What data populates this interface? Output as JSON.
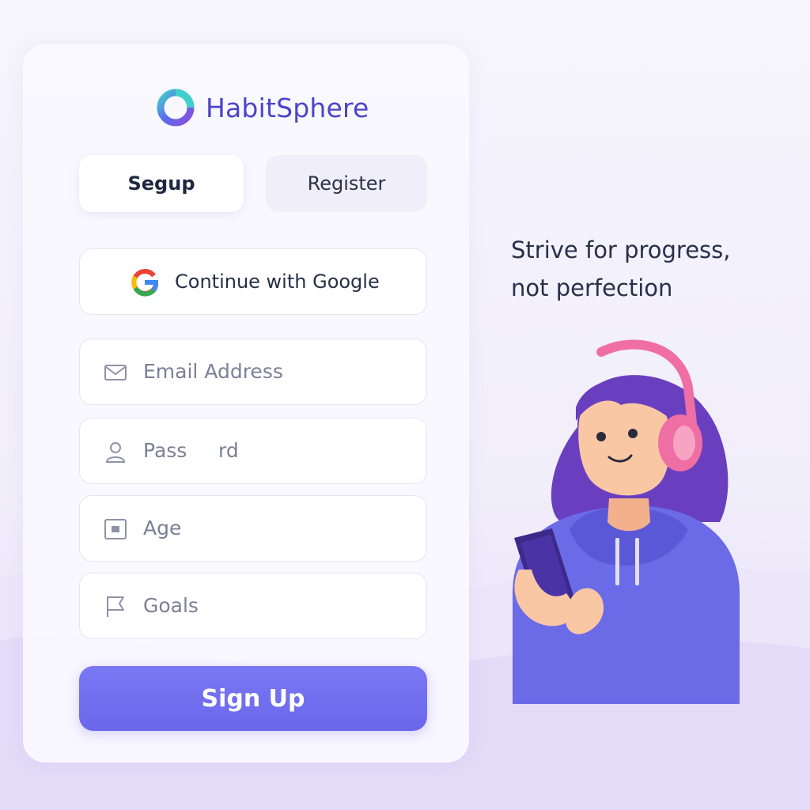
{
  "app": {
    "name": "HabitSphere",
    "logo_icon": "ring-logo-icon"
  },
  "tabs": [
    {
      "label": "Segup",
      "active": true
    },
    {
      "label": "Register",
      "active": false
    }
  ],
  "google_button": {
    "label": "Continue with Google",
    "icon": "google-icon"
  },
  "fields": {
    "email": {
      "placeholder": "Email Address",
      "icon": "mail-icon"
    },
    "password": {
      "placeholder": "Pass     rd",
      "icon": "user-icon"
    },
    "age": {
      "placeholder": "Age",
      "icon": "id-card-icon"
    },
    "goals": {
      "placeholder": "Goals",
      "icon": "flag-icon"
    }
  },
  "signup_button": {
    "label": "Sign Up"
  },
  "quote": {
    "line1": "Strive for progress,",
    "line2": "not perfection"
  },
  "illustration": {
    "subject": "girl-with-headphones-and-phone"
  },
  "colors": {
    "brand": "#4b45c9",
    "accent": "#6f6cf0",
    "text": "#28304a",
    "placeholder": "#7a8095",
    "hoodie": "#6b6be8",
    "hair": "#6a3fbf",
    "headphones": "#ef6fa4"
  }
}
